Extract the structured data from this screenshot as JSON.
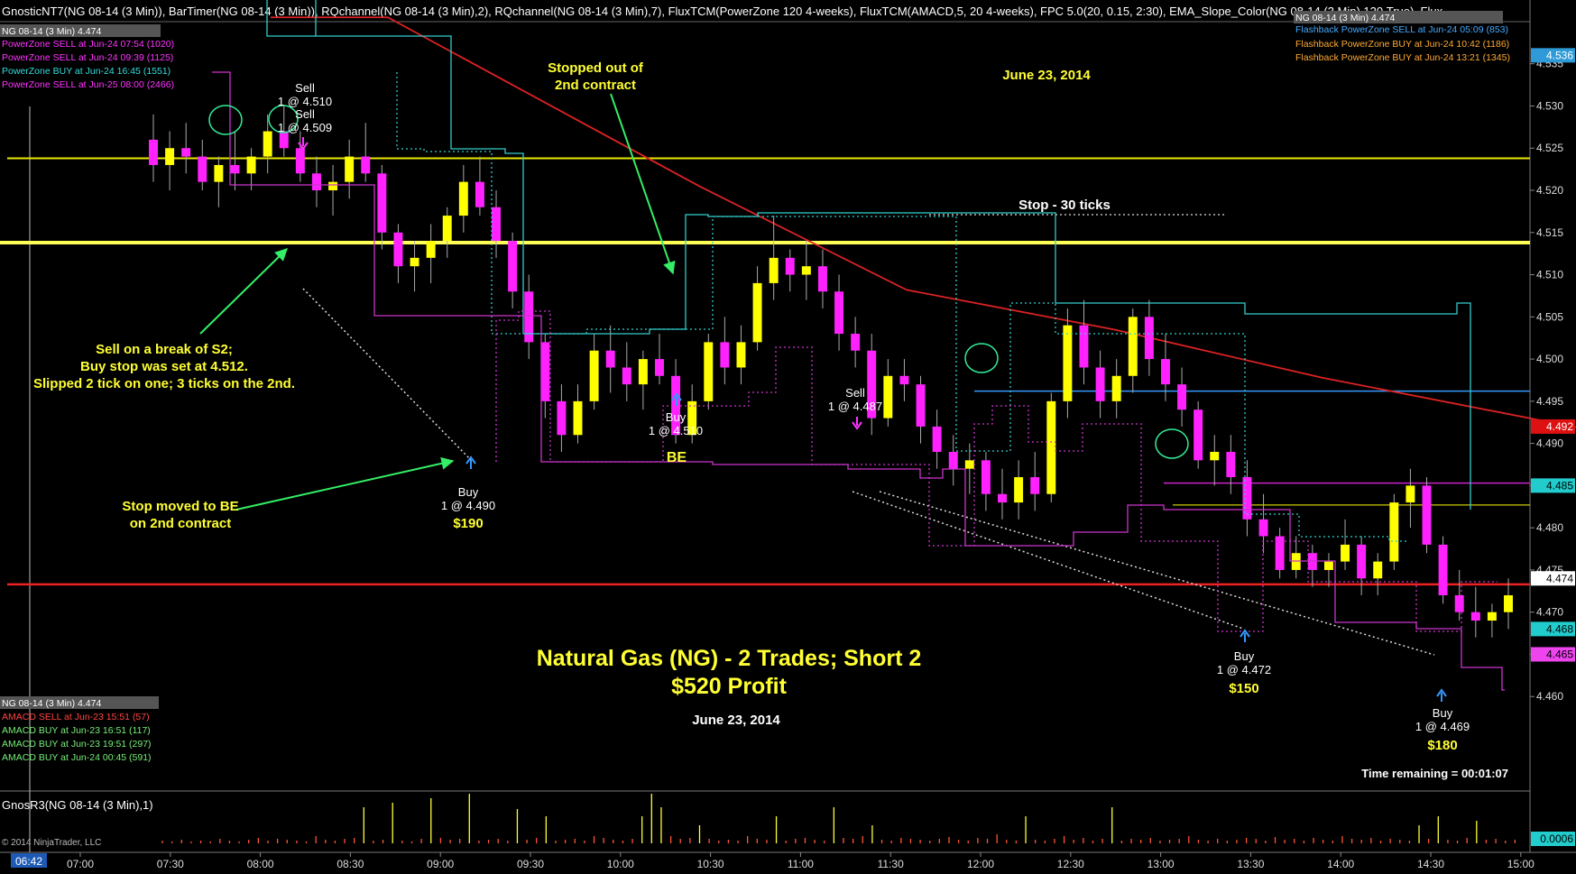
{
  "header": {
    "indicators": "GnosticNT7(NG 08-14 (3 Min)),  BarTimer(NG 08-14 (3 Min)),  RQchannel(NG 08-14 (3 Min),2),  RQchannel(NG 08-14 (3 Min),7),  FluxTCM(PowerZone 120 4-weeks),  FluxTCM(AMACD,5, 20 4-weeks),  FPC 5.0(20, 0.15, 2:30),  EMA_Slope_Color(NG 08-14 (3 Min),120,True),  Flux"
  },
  "top_left_panel": {
    "instrument": "NG 08-14 (3 Min) 4.474",
    "alerts": [
      {
        "text": "PowerZone SELL at Jun-24 07:54 (1020)",
        "color": "#ff33ff"
      },
      {
        "text": "PowerZone SELL at Jun-24 09:39 (1125)",
        "color": "#ff33ff"
      },
      {
        "text": "PowerZone BUY at Jun-24 16:45 (1551)",
        "color": "#33dddd"
      },
      {
        "text": "PowerZone SELL at Jun-25 08:00 (2466)",
        "color": "#ff33ff"
      }
    ]
  },
  "top_right_panel": {
    "header": "NG 08-14 (3 Min) 4.474",
    "alerts": [
      {
        "text": "Flashback PowerZone SELL at Jun-24 05:09 (853)",
        "color": "#44aaff"
      },
      {
        "text": "Flashback PowerZone BUY at Jun-24 10:42 (1186)",
        "color": "#ffaa33"
      },
      {
        "text": "Flashback PowerZone BUY at Jun-24 13:21 (1345)",
        "color": "#ffaa33"
      }
    ]
  },
  "bottom_left_panel": {
    "instrument": "NG 08-14 (3 Min) 4.474",
    "alerts": [
      {
        "text": "AMACD SELL at Jun-23 15:51 (57)",
        "color": "#ff4444"
      },
      {
        "text": "AMACD BUY at Jun-23 16:51 (117)",
        "color": "#77ee77"
      },
      {
        "text": "AMACD BUY at Jun-23 19:51 (297)",
        "color": "#77ee77"
      },
      {
        "text": "AMACD BUY at Jun-24 00:45 (591)",
        "color": "#77ee77"
      }
    ]
  },
  "annotations": {
    "date_top": "June 23, 2014",
    "date_bottom": "June 23, 2014",
    "stop_label": "Stop - 30 ticks",
    "stopped_out": [
      "Stopped out of",
      "2nd contract"
    ],
    "sell_break": [
      "Sell on a break of S2;",
      "Buy stop was set at 4.512.",
      "Slipped 2 tick on one; 3 ticks on the 2nd."
    ],
    "stop_be": [
      "Stop moved to BE",
      "on 2nd contract"
    ],
    "title_line1": "Natural Gas (NG) - 2 Trades; Short 2",
    "title_line2": "$520 Profit",
    "time_remaining": "Time remaining = 00:01:07",
    "be": "BE",
    "trades": [
      {
        "side": "Sell",
        "detail": "1 @ 4.510",
        "profit": ""
      },
      {
        "side": "Sell",
        "detail": "1 @ 4.509",
        "profit": ""
      },
      {
        "side": "Buy",
        "detail": "1 @ 4.490",
        "profit": "$190"
      },
      {
        "side": "Buy",
        "detail": "1 @ 4.510",
        "profit": ""
      },
      {
        "side": "Sell",
        "detail": "1 @ 4.487",
        "profit": ""
      },
      {
        "side": "Buy",
        "detail": "1 @ 4.472",
        "profit": "$150"
      },
      {
        "side": "Buy",
        "detail": "1 @ 4.469",
        "profit": "$180"
      }
    ]
  },
  "price_tags": [
    {
      "label": "4.536",
      "bg": "#2f9ad8",
      "color": "#ffffff"
    },
    {
      "label": "4.492",
      "bg": "#dd1111",
      "color": "#ffffff"
    },
    {
      "label": "4.485",
      "bg": "#22cccc",
      "color": "#000000"
    },
    {
      "label": "4.474",
      "bg": "#ffffff",
      "color": "#000000"
    },
    {
      "label": "4.468",
      "bg": "#22cccc",
      "color": "#000000"
    },
    {
      "label": "4.465",
      "bg": "#ee44ee",
      "color": "#000000"
    },
    {
      "label": "0.0006",
      "bg": "#22cccc",
      "color": "#000000"
    }
  ],
  "volume_panel": {
    "label": "GnosR3(NG 08-14 (3 Min),1)"
  },
  "copyright": "© 2014 NinjaTrader, LLC",
  "current_time_tag": "06:42",
  "chart_data": {
    "type": "candlestick",
    "instrument": "NG 08-14",
    "interval": "3 Min",
    "ylim": [
      4.455,
      4.537
    ],
    "y_ticks": [
      "4.535",
      "4.530",
      "4.525",
      "4.520",
      "4.515",
      "4.510",
      "4.505",
      "4.500",
      "4.495",
      "4.490",
      "4.485",
      "4.480",
      "4.475",
      "4.470",
      "4.465",
      "4.460"
    ],
    "x_ticks": [
      "07:00",
      "07:30",
      "08:00",
      "08:30",
      "09:00",
      "09:30",
      "10:00",
      "10:30",
      "11:00",
      "11:30",
      "12:00",
      "12:30",
      "13:00",
      "13:30",
      "14:00",
      "14:30",
      "15:00"
    ],
    "horizontal_lines": [
      {
        "name": "yellow-level-upper",
        "y": 4.5238,
        "color": "#e8e800"
      },
      {
        "name": "yellow-level-thick",
        "y": 4.5138,
        "color": "#ffff55"
      },
      {
        "name": "red-level",
        "y": 4.4733,
        "color": "#ee2222"
      },
      {
        "name": "blue-level",
        "y": 4.4962,
        "color": "#3399ff"
      },
      {
        "name": "magenta-level",
        "y": 4.4853,
        "color": "#cc22cc"
      },
      {
        "name": "yellow-level-right",
        "y": 4.4827,
        "color": "#cccc00"
      }
    ],
    "ema_120": [
      [
        0,
        4.5405
      ],
      [
        60,
        4.5205
      ],
      [
        100,
        4.5082
      ],
      [
        140,
        4.5035
      ],
      [
        180,
        4.4978
      ],
      [
        230,
        4.4918
      ]
    ],
    "candles": [
      {
        "t": 0,
        "o": 4.526,
        "h": 4.529,
        "l": 4.521,
        "c": 4.523
      },
      {
        "t": 1,
        "o": 4.523,
        "h": 4.527,
        "l": 4.52,
        "c": 4.525
      },
      {
        "t": 2,
        "o": 4.525,
        "h": 4.528,
        "l": 4.522,
        "c": 4.524
      },
      {
        "t": 3,
        "o": 4.524,
        "h": 4.526,
        "l": 4.52,
        "c": 4.521
      },
      {
        "t": 4,
        "o": 4.521,
        "h": 4.524,
        "l": 4.518,
        "c": 4.523
      },
      {
        "t": 5,
        "o": 4.523,
        "h": 4.527,
        "l": 4.52,
        "c": 4.522
      },
      {
        "t": 6,
        "o": 4.522,
        "h": 4.525,
        "l": 4.52,
        "c": 4.524
      },
      {
        "t": 7,
        "o": 4.524,
        "h": 4.529,
        "l": 4.522,
        "c": 4.527
      },
      {
        "t": 8,
        "o": 4.527,
        "h": 4.53,
        "l": 4.524,
        "c": 4.525
      },
      {
        "t": 9,
        "o": 4.525,
        "h": 4.527,
        "l": 4.521,
        "c": 4.522
      },
      {
        "t": 10,
        "o": 4.522,
        "h": 4.524,
        "l": 4.518,
        "c": 4.52
      },
      {
        "t": 11,
        "o": 4.52,
        "h": 4.523,
        "l": 4.517,
        "c": 4.521
      },
      {
        "t": 12,
        "o": 4.521,
        "h": 4.526,
        "l": 4.519,
        "c": 4.524
      },
      {
        "t": 13,
        "o": 4.524,
        "h": 4.528,
        "l": 4.521,
        "c": 4.522
      },
      {
        "t": 14,
        "o": 4.522,
        "h": 4.523,
        "l": 4.513,
        "c": 4.515
      },
      {
        "t": 15,
        "o": 4.515,
        "h": 4.516,
        "l": 4.509,
        "c": 4.511
      },
      {
        "t": 16,
        "o": 4.511,
        "h": 4.514,
        "l": 4.508,
        "c": 4.512
      },
      {
        "t": 17,
        "o": 4.512,
        "h": 4.516,
        "l": 4.509,
        "c": 4.514
      },
      {
        "t": 18,
        "o": 4.514,
        "h": 4.518,
        "l": 4.512,
        "c": 4.517
      },
      {
        "t": 19,
        "o": 4.517,
        "h": 4.523,
        "l": 4.515,
        "c": 4.521
      },
      {
        "t": 20,
        "o": 4.521,
        "h": 4.524,
        "l": 4.517,
        "c": 4.518
      },
      {
        "t": 21,
        "o": 4.518,
        "h": 4.52,
        "l": 4.512,
        "c": 4.514
      },
      {
        "t": 22,
        "o": 4.514,
        "h": 4.515,
        "l": 4.506,
        "c": 4.508
      },
      {
        "t": 23,
        "o": 4.508,
        "h": 4.51,
        "l": 4.5,
        "c": 4.502
      },
      {
        "t": 24,
        "o": 4.502,
        "h": 4.503,
        "l": 4.493,
        "c": 4.495
      },
      {
        "t": 25,
        "o": 4.495,
        "h": 4.497,
        "l": 4.489,
        "c": 4.491
      },
      {
        "t": 26,
        "o": 4.491,
        "h": 4.497,
        "l": 4.49,
        "c": 4.495
      },
      {
        "t": 27,
        "o": 4.495,
        "h": 4.503,
        "l": 4.494,
        "c": 4.501
      },
      {
        "t": 28,
        "o": 4.501,
        "h": 4.504,
        "l": 4.496,
        "c": 4.499
      },
      {
        "t": 29,
        "o": 4.499,
        "h": 4.502,
        "l": 4.495,
        "c": 4.497
      },
      {
        "t": 30,
        "o": 4.497,
        "h": 4.501,
        "l": 4.494,
        "c": 4.5
      },
      {
        "t": 31,
        "o": 4.5,
        "h": 4.503,
        "l": 4.497,
        "c": 4.498
      },
      {
        "t": 32,
        "o": 4.498,
        "h": 4.5,
        "l": 4.49,
        "c": 4.491
      },
      {
        "t": 33,
        "o": 4.491,
        "h": 4.497,
        "l": 4.49,
        "c": 4.495
      },
      {
        "t": 34,
        "o": 4.495,
        "h": 4.503,
        "l": 4.494,
        "c": 4.502
      },
      {
        "t": 35,
        "o": 4.502,
        "h": 4.505,
        "l": 4.497,
        "c": 4.499
      },
      {
        "t": 36,
        "o": 4.499,
        "h": 4.504,
        "l": 4.497,
        "c": 4.502
      },
      {
        "t": 37,
        "o": 4.502,
        "h": 4.511,
        "l": 4.501,
        "c": 4.509
      },
      {
        "t": 38,
        "o": 4.509,
        "h": 4.517,
        "l": 4.507,
        "c": 4.512
      },
      {
        "t": 39,
        "o": 4.512,
        "h": 4.513,
        "l": 4.508,
        "c": 4.51
      },
      {
        "t": 40,
        "o": 4.51,
        "h": 4.514,
        "l": 4.507,
        "c": 4.511
      },
      {
        "t": 41,
        "o": 4.511,
        "h": 4.513,
        "l": 4.506,
        "c": 4.508
      },
      {
        "t": 42,
        "o": 4.508,
        "h": 4.51,
        "l": 4.501,
        "c": 4.503
      },
      {
        "t": 43,
        "o": 4.503,
        "h": 4.505,
        "l": 4.499,
        "c": 4.501
      },
      {
        "t": 44,
        "o": 4.501,
        "h": 4.503,
        "l": 4.491,
        "c": 4.493
      },
      {
        "t": 45,
        "o": 4.493,
        "h": 4.5,
        "l": 4.492,
        "c": 4.498
      },
      {
        "t": 46,
        "o": 4.498,
        "h": 4.5,
        "l": 4.495,
        "c": 4.497
      },
      {
        "t": 47,
        "o": 4.497,
        "h": 4.498,
        "l": 4.49,
        "c": 4.492
      },
      {
        "t": 48,
        "o": 4.492,
        "h": 4.494,
        "l": 4.487,
        "c": 4.489
      },
      {
        "t": 49,
        "o": 4.489,
        "h": 4.491,
        "l": 4.485,
        "c": 4.487
      },
      {
        "t": 50,
        "o": 4.487,
        "h": 4.49,
        "l": 4.484,
        "c": 4.488
      },
      {
        "t": 51,
        "o": 4.488,
        "h": 4.489,
        "l": 4.482,
        "c": 4.484
      },
      {
        "t": 52,
        "o": 4.484,
        "h": 4.487,
        "l": 4.481,
        "c": 4.483
      },
      {
        "t": 53,
        "o": 4.483,
        "h": 4.488,
        "l": 4.481,
        "c": 4.486
      },
      {
        "t": 54,
        "o": 4.486,
        "h": 4.489,
        "l": 4.482,
        "c": 4.484
      },
      {
        "t": 55,
        "o": 4.484,
        "h": 4.496,
        "l": 4.483,
        "c": 4.495
      },
      {
        "t": 56,
        "o": 4.495,
        "h": 4.506,
        "l": 4.493,
        "c": 4.504
      },
      {
        "t": 57,
        "o": 4.504,
        "h": 4.507,
        "l": 4.497,
        "c": 4.499
      },
      {
        "t": 58,
        "o": 4.499,
        "h": 4.501,
        "l": 4.493,
        "c": 4.495
      },
      {
        "t": 59,
        "o": 4.495,
        "h": 4.5,
        "l": 4.493,
        "c": 4.498
      },
      {
        "t": 60,
        "o": 4.498,
        "h": 4.506,
        "l": 4.496,
        "c": 4.505
      },
      {
        "t": 61,
        "o": 4.505,
        "h": 4.507,
        "l": 4.498,
        "c": 4.5
      },
      {
        "t": 62,
        "o": 4.5,
        "h": 4.503,
        "l": 4.495,
        "c": 4.497
      },
      {
        "t": 63,
        "o": 4.497,
        "h": 4.499,
        "l": 4.492,
        "c": 4.494
      },
      {
        "t": 64,
        "o": 4.494,
        "h": 4.495,
        "l": 4.487,
        "c": 4.488
      },
      {
        "t": 65,
        "o": 4.488,
        "h": 4.491,
        "l": 4.485,
        "c": 4.489
      },
      {
        "t": 66,
        "o": 4.489,
        "h": 4.491,
        "l": 4.484,
        "c": 4.486
      },
      {
        "t": 67,
        "o": 4.486,
        "h": 4.488,
        "l": 4.479,
        "c": 4.481
      },
      {
        "t": 68,
        "o": 4.481,
        "h": 4.484,
        "l": 4.477,
        "c": 4.479
      },
      {
        "t": 69,
        "o": 4.479,
        "h": 4.48,
        "l": 4.474,
        "c": 4.475
      },
      {
        "t": 70,
        "o": 4.475,
        "h": 4.479,
        "l": 4.474,
        "c": 4.477
      },
      {
        "t": 71,
        "o": 4.477,
        "h": 4.478,
        "l": 4.473,
        "c": 4.475
      },
      {
        "t": 72,
        "o": 4.475,
        "h": 4.477,
        "l": 4.473,
        "c": 4.476
      },
      {
        "t": 73,
        "o": 4.476,
        "h": 4.481,
        "l": 4.475,
        "c": 4.478
      },
      {
        "t": 74,
        "o": 4.478,
        "h": 4.479,
        "l": 4.472,
        "c": 4.474
      },
      {
        "t": 75,
        "o": 4.474,
        "h": 4.477,
        "l": 4.472,
        "c": 4.476
      },
      {
        "t": 76,
        "o": 4.476,
        "h": 4.484,
        "l": 4.475,
        "c": 4.483
      },
      {
        "t": 77,
        "o": 4.483,
        "h": 4.487,
        "l": 4.48,
        "c": 4.485
      },
      {
        "t": 78,
        "o": 4.485,
        "h": 4.486,
        "l": 4.477,
        "c": 4.478
      },
      {
        "t": 79,
        "o": 4.478,
        "h": 4.479,
        "l": 4.471,
        "c": 4.472
      },
      {
        "t": 80,
        "o": 4.472,
        "h": 4.475,
        "l": 4.469,
        "c": 4.47
      },
      {
        "t": 81,
        "o": 4.47,
        "h": 4.473,
        "l": 4.467,
        "c": 4.469
      },
      {
        "t": 82,
        "o": 4.469,
        "h": 4.471,
        "l": 4.467,
        "c": 4.47
      },
      {
        "t": 83,
        "o": 4.47,
        "h": 4.474,
        "l": 4.468,
        "c": 4.472
      }
    ]
  }
}
